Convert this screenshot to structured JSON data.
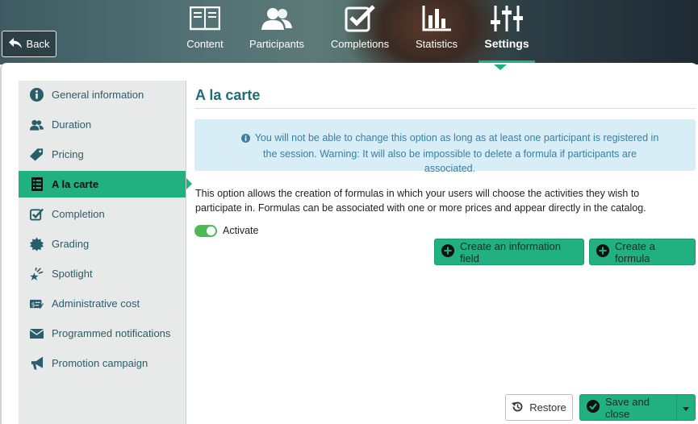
{
  "header": {
    "back_label": "Back",
    "tabs": [
      {
        "label": "Content",
        "icon": "book-icon"
      },
      {
        "label": "Participants",
        "icon": "users-icon"
      },
      {
        "label": "Completions",
        "icon": "checkbox-icon"
      },
      {
        "label": "Statistics",
        "icon": "bar-chart-icon"
      },
      {
        "label": "Settings",
        "icon": "sliders-icon",
        "active": true
      }
    ]
  },
  "sidebar": {
    "items": [
      {
        "label": "General information",
        "icon": "info-circle-icon"
      },
      {
        "label": "Duration",
        "icon": "users-icon"
      },
      {
        "label": "Pricing",
        "icon": "tag-icon"
      },
      {
        "label": "A la carte",
        "icon": "list-icon",
        "active": true
      },
      {
        "label": "Completion",
        "icon": "check-square-icon"
      },
      {
        "label": "Grading",
        "icon": "badge-icon"
      },
      {
        "label": "Spotlight",
        "icon": "star-spotlight-icon"
      },
      {
        "label": "Administrative cost",
        "icon": "money-icon"
      },
      {
        "label": "Programmed notifications",
        "icon": "envelope-icon"
      },
      {
        "label": "Promotion campaign",
        "icon": "megaphone-icon"
      }
    ]
  },
  "main": {
    "title": "A la carte",
    "info": "You will not be able to change this option as long as at least one participant is registered in the session. Warning: It will also be impossible to delete a formula if participants are associated.",
    "description": "This option allows the creation of formulas in which your users will choose the activities they wish to participate in. Formulas can be associated with one or more prices and appear directly in the catalog.",
    "activate_label": "Activate",
    "activate_on": true,
    "create_info_field_label": "Create an information field",
    "create_formula_label": "Create a formula"
  },
  "footer": {
    "restore_label": "Restore",
    "save_label": "Save and close"
  },
  "colors": {
    "accent": "#21b07f",
    "title": "#1f6c74",
    "sidebar_text": "#2a5d6b",
    "info_bg": "#d9edf7",
    "info_text": "#3a7ea0"
  }
}
